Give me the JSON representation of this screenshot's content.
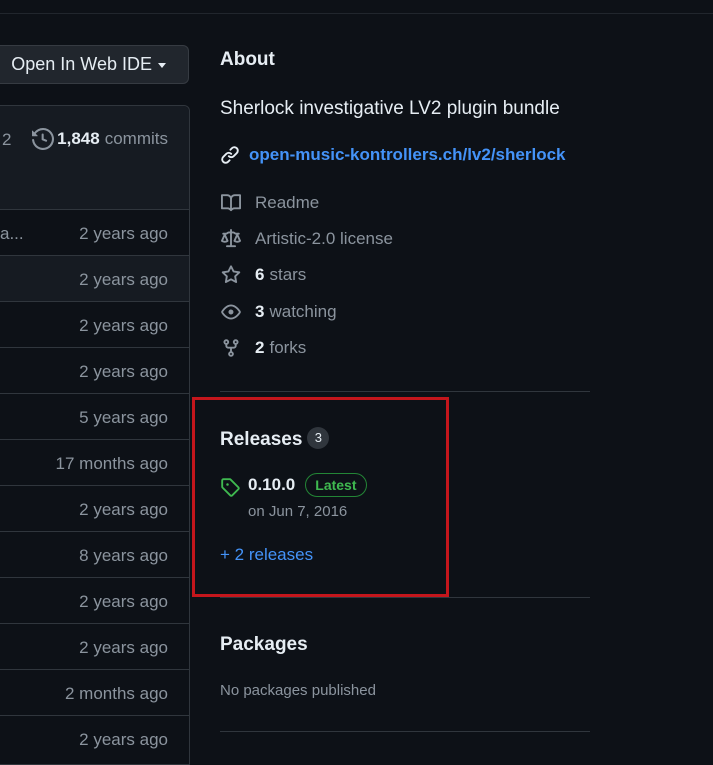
{
  "toolbar": {
    "ide_label": "Open In Web IDE"
  },
  "files": {
    "header_partial": "2",
    "commit_count": "1,848",
    "commit_word": "commits",
    "first_row_truncated": "a...",
    "ages": [
      "2 years ago",
      "2 years ago",
      "2 years ago",
      "2 years ago",
      "5 years ago",
      "17 months ago",
      "2 years ago",
      "8 years ago",
      "2 years ago",
      "2 years ago",
      "2 months ago",
      "2 years ago"
    ]
  },
  "about": {
    "title": "About",
    "description": "Sherlock investigative LV2 plugin bundle",
    "link": "open-music-kontrollers.ch/lv2/sherlock",
    "readme": "Readme",
    "license": "Artistic-2.0 license",
    "stars_count": "6",
    "stars_label": "stars",
    "watching_count": "3",
    "watching_label": "watching",
    "forks_count": "2",
    "forks_label": "forks"
  },
  "releases": {
    "title": "Releases",
    "count": "3",
    "version": "0.10.0",
    "latest_label": "Latest",
    "date": "on Jun 7, 2016",
    "more": "+ 2 releases"
  },
  "packages": {
    "title": "Packages",
    "empty": "No packages published"
  },
  "colors": {
    "accent": "#4493f8",
    "highlight_border": "#c4161c",
    "latest_green": "#3fb950"
  }
}
